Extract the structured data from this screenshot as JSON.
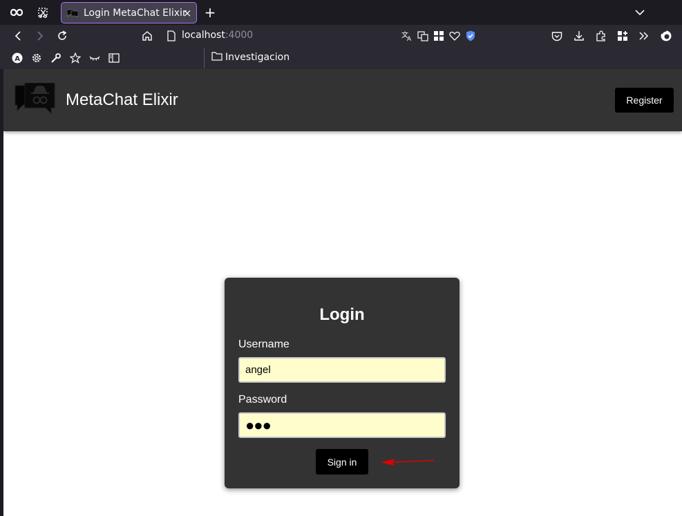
{
  "browser": {
    "tab": {
      "title": "Login MetaChat Elixir",
      "close": "×"
    },
    "new_tab": "+",
    "url": {
      "host": "localhost",
      "port": ":4000"
    },
    "bookmarks": {
      "folder": "Investigacion"
    },
    "toolbar_icons": [
      "container-icon",
      "screenshot-icon",
      "back-icon",
      "forward-icon",
      "reload-icon",
      "home-icon",
      "page-icon",
      "translate-icon",
      "translate-page-icon",
      "grid-icon",
      "heart-icon",
      "shield-check-icon",
      "pocket-icon",
      "download-icon",
      "extensions-icon",
      "apps-icon",
      "overflow-icon",
      "firefox-icon"
    ]
  },
  "app": {
    "title": "MetaChat Elixir",
    "register_label": "Register",
    "logo": "metachat-logo-icon"
  },
  "login": {
    "title": "Login",
    "username_label": "Username",
    "username_value": "angel",
    "password_label": "Password",
    "password_value": "●●●",
    "signin_label": "Sign in"
  },
  "colors": {
    "chrome_dark": "#1c1b22",
    "toolbar": "#2b2a33",
    "tab_border": "#a872f5",
    "header": "#333333",
    "card": "#333333",
    "input_bg": "#fffdcc",
    "button": "#000000",
    "arrow": "#e00000",
    "shield": "#5a8cf5"
  }
}
